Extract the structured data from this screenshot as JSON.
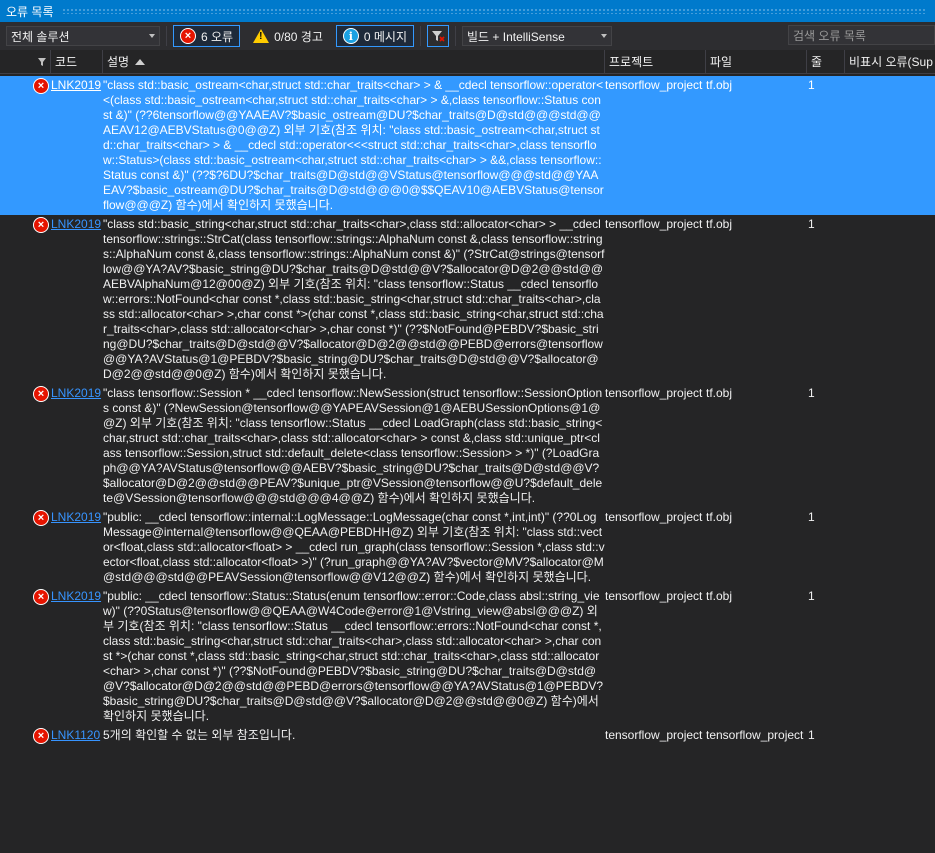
{
  "window": {
    "title": "오류 목록"
  },
  "toolbar": {
    "scope_value": "전체 솔루션",
    "errors_label": "6 오류",
    "warnings_label": "0/80 경고",
    "messages_label": "0 메시지",
    "build_filter_value": "빌드 + IntelliSense",
    "search_placeholder": "검색 오류 목록"
  },
  "columns": {
    "code": "코드",
    "description": "설명",
    "project": "프로젝트",
    "file": "파일",
    "line": "줄",
    "suppression": "비표시 오류(Sup"
  },
  "rows": [
    {
      "code": "LNK2019",
      "description": "\"class std::basic_ostream<char,struct std::char_traits<char> > & __cdecl tensorflow::operator<<(class std::basic_ostream<char,struct std::char_traits<char> > &,class tensorflow::Status const &)\" (??6tensorflow@@YAAEAV?$basic_ostream@DU?$char_traits@D@std@@@std@@AEAV12@AEBVStatus@0@@Z) 외부 기호(참조 위치: \"class std::basic_ostream<char,struct std::char_traits<char> > & __cdecl std::operator<<<struct std::char_traits<char>,class tensorflow::Status>(class std::basic_ostream<char,struct std::char_traits<char> > &&,class tensorflow::Status const &)\" (??$?6DU?$char_traits@D@std@@VStatus@tensorflow@@@std@@YAAEAV?$basic_ostream@DU?$char_traits@D@std@@@0@$$QEAV10@AEBVStatus@tensorflow@@@Z) 함수)에서 확인하지 못했습니다.",
      "project": "tensorflow_project",
      "file": "tf.obj",
      "line": "1"
    },
    {
      "code": "LNK2019",
      "description": "\"class std::basic_string<char,struct std::char_traits<char>,class std::allocator<char> > __cdecl tensorflow::strings::StrCat(class tensorflow::strings::AlphaNum const &,class tensorflow::strings::AlphaNum const &,class tensorflow::strings::AlphaNum const &)\" (?StrCat@strings@tensorflow@@YA?AV?$basic_string@DU?$char_traits@D@std@@V?$allocator@D@2@@std@@AEBVAlphaNum@12@00@Z) 외부 기호(참조 위치: \"class tensorflow::Status __cdecl tensorflow::errors::NotFound<char const *,class std::basic_string<char,struct std::char_traits<char>,class std::allocator<char> >,char const *>(char const *,class std::basic_string<char,struct std::char_traits<char>,class std::allocator<char> >,char const *)\" (??$NotFound@PEBDV?$basic_string@DU?$char_traits@D@std@@V?$allocator@D@2@@std@@PEBD@errors@tensorflow@@YA?AVStatus@1@PEBDV?$basic_string@DU?$char_traits@D@std@@V?$allocator@D@2@@std@@0@Z) 함수)에서 확인하지 못했습니다.",
      "project": "tensorflow_project",
      "file": "tf.obj",
      "line": "1"
    },
    {
      "code": "LNK2019",
      "description": "\"class tensorflow::Session * __cdecl tensorflow::NewSession(struct tensorflow::SessionOptions const &)\" (?NewSession@tensorflow@@YAPEAVSession@1@AEBUSessionOptions@1@@Z) 외부 기호(참조 위치: \"class tensorflow::Status __cdecl LoadGraph(class std::basic_string<char,struct std::char_traits<char>,class std::allocator<char> > const &,class std::unique_ptr<class tensorflow::Session,struct std::default_delete<class tensorflow::Session> > *)\" (?LoadGraph@@YA?AVStatus@tensorflow@@AEBV?$basic_string@DU?$char_traits@D@std@@V?$allocator@D@2@@std@@PEAV?$unique_ptr@VSession@tensorflow@@U?$default_delete@VSession@tensorflow@@@std@@@4@@Z) 함수)에서 확인하지 못했습니다.",
      "project": "tensorflow_project",
      "file": "tf.obj",
      "line": "1"
    },
    {
      "code": "LNK2019",
      "description": "\"public: __cdecl tensorflow::internal::LogMessage::LogMessage(char const *,int,int)\" (??0LogMessage@internal@tensorflow@@QEAA@PEBDHH@Z) 외부 기호(참조 위치: \"class std::vector<float,class std::allocator<float> > __cdecl run_graph(class tensorflow::Session *,class std::vector<float,class std::allocator<float> >)\" (?run_graph@@YA?AV?$vector@MV?$allocator@M@std@@@std@@PEAVSession@tensorflow@@V12@@Z) 함수)에서 확인하지 못했습니다.",
      "project": "tensorflow_project",
      "file": "tf.obj",
      "line": "1"
    },
    {
      "code": "LNK2019",
      "description": "\"public: __cdecl tensorflow::Status::Status(enum tensorflow::error::Code,class absl::string_view)\" (??0Status@tensorflow@@QEAA@W4Code@error@1@Vstring_view@absl@@@Z) 외부 기호(참조 위치: \"class tensorflow::Status __cdecl tensorflow::errors::NotFound<char const *,class std::basic_string<char,struct std::char_traits<char>,class std::allocator<char> >,char const *>(char const *,class std::basic_string<char,struct std::char_traits<char>,class std::allocator<char> >,char const *)\" (??$NotFound@PEBDV?$basic_string@DU?$char_traits@D@std@@V?$allocator@D@2@@std@@PEBD@errors@tensorflow@@YA?AVStatus@1@PEBDV?$basic_string@DU?$char_traits@D@std@@V?$allocator@D@2@@std@@0@Z) 함수)에서 확인하지 못했습니다.",
      "project": "tensorflow_project",
      "file": "tf.obj",
      "line": "1"
    },
    {
      "code": "LNK1120",
      "description": "5개의 확인할 수 없는 외부 참조입니다.",
      "project": "tensorflow_project",
      "file": "tensorflow_project",
      "line": "1"
    }
  ]
}
